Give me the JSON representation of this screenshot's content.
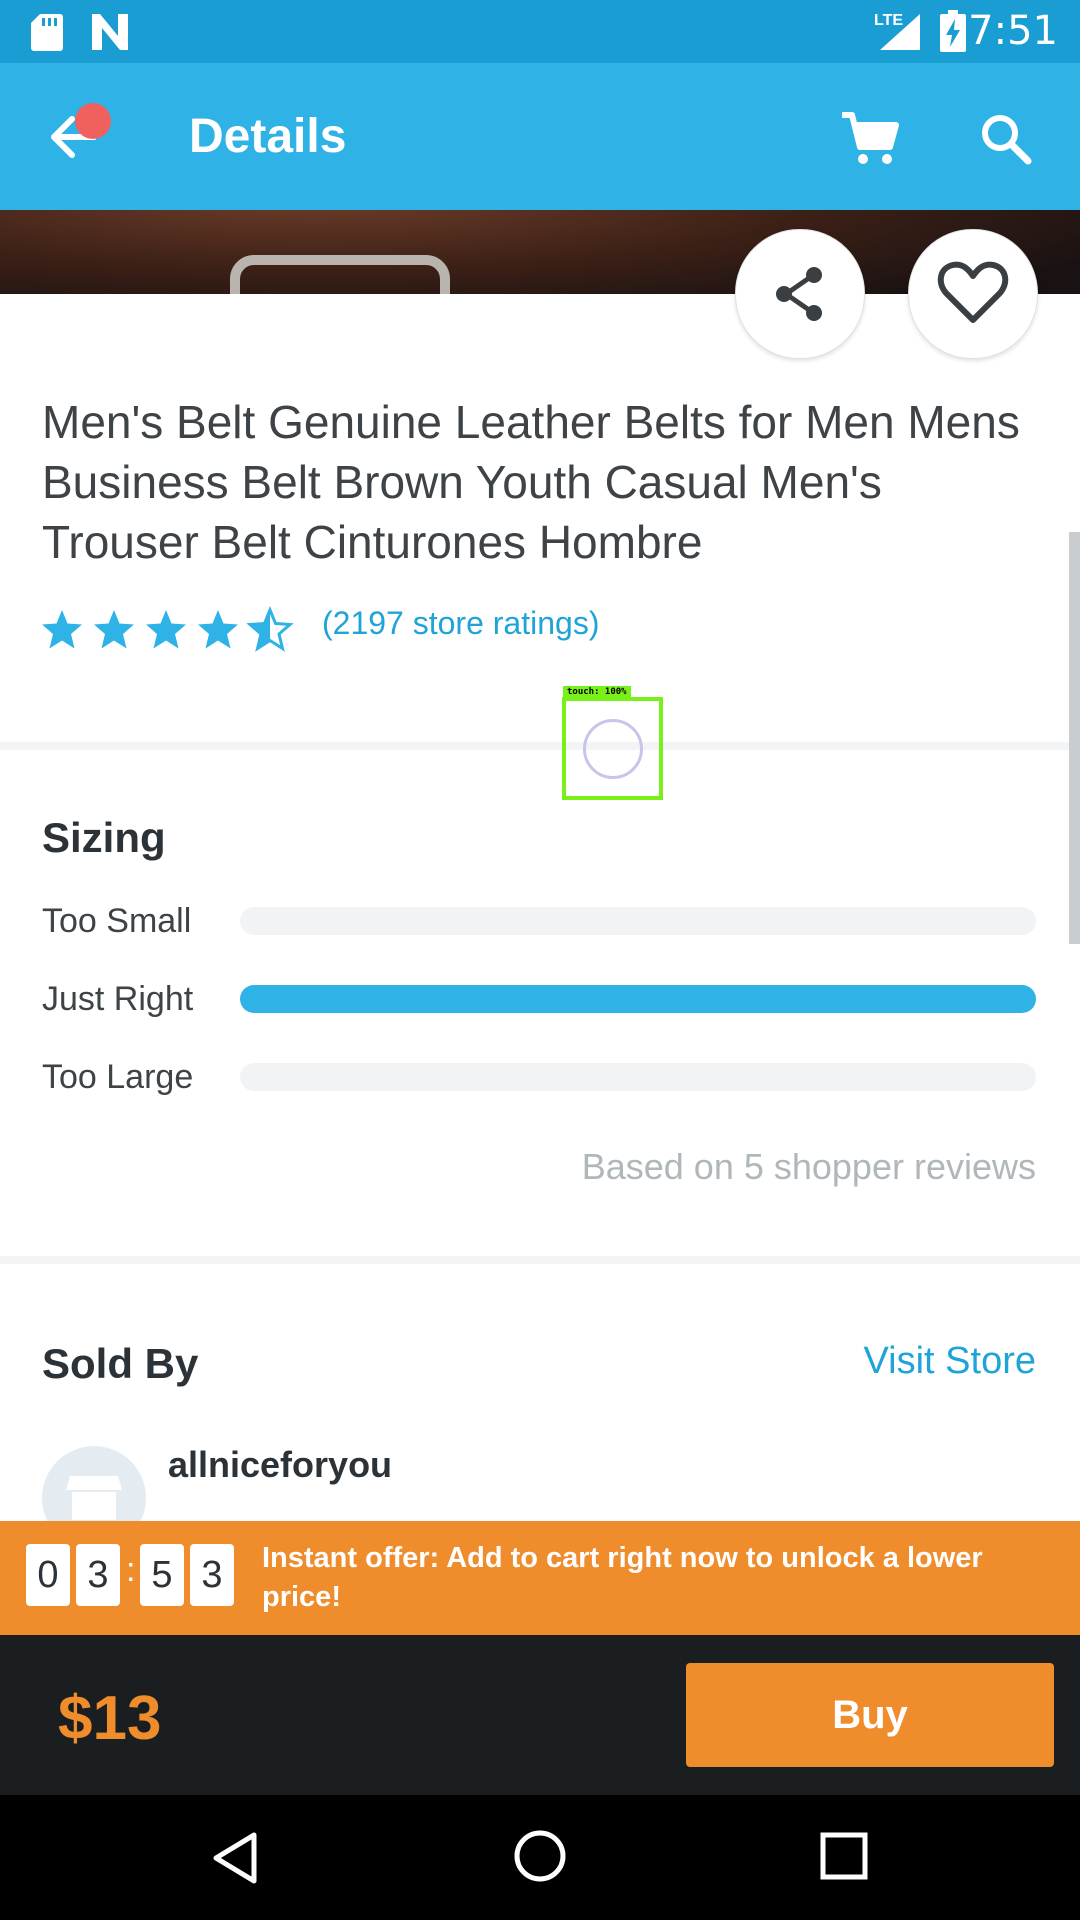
{
  "status_bar": {
    "time": "7:51",
    "network_label": "LTE",
    "icons": [
      "sd-card-icon",
      "n-app-icon",
      "signal-icon",
      "battery-charging-icon"
    ]
  },
  "app_bar": {
    "title": "Details",
    "icons": [
      "back-arrow-icon",
      "notification-dot",
      "cart-icon",
      "search-icon"
    ]
  },
  "product": {
    "title": "Men's Belt Genuine Leather Belts for Men Mens Business Belt Brown Youth Casual Men's Trouser Belt Cinturones Hombre",
    "rating": 4.5,
    "rating_max": 5,
    "ratings_text": "(2197 store ratings)",
    "actions": [
      "share-icon",
      "heart-icon"
    ]
  },
  "touch_overlay": {
    "label": "touch: 100%"
  },
  "sizing": {
    "title": "Sizing",
    "rows": [
      {
        "label": "Too Small",
        "fraction": 0.0
      },
      {
        "label": "Just Right",
        "fraction": 1.0
      },
      {
        "label": "Too Large",
        "fraction": 0.0
      }
    ],
    "based_on": "Based on 5 shopper reviews"
  },
  "sold_by": {
    "title": "Sold By",
    "visit_store": "Visit Store",
    "store_name": "allniceforyou"
  },
  "offer": {
    "timer_digits": [
      "0",
      "3",
      "5",
      "3"
    ],
    "separator": ":",
    "text": "Instant offer: Add to cart right now to unlock a lower price!"
  },
  "purchase": {
    "price": "$13",
    "buy_label": "Buy"
  },
  "colors": {
    "primary": "#2fb2e6",
    "status_bar": "#199dd3",
    "accent_orange": "#ef8c2c",
    "dark_bar": "#1b1e21"
  }
}
